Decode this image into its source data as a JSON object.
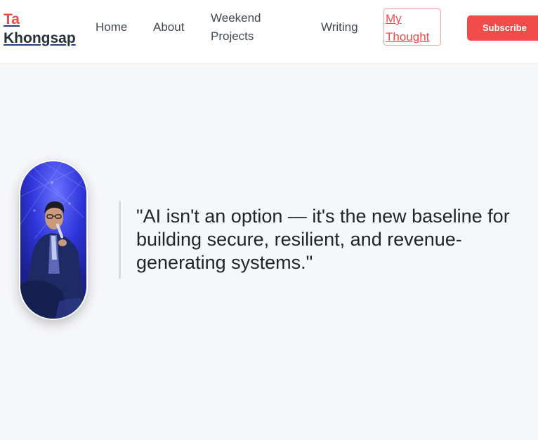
{
  "brand": {
    "first_name": "Ta",
    "last_name": "Khongsap"
  },
  "nav": {
    "items": [
      {
        "label": "Home"
      },
      {
        "label": "About"
      },
      {
        "label": "Weekend Projects"
      },
      {
        "label": "Writing"
      },
      {
        "label": "My Thought",
        "active": true
      }
    ],
    "subscribe_label": "Subscribe"
  },
  "hero": {
    "quote": "\"AI isn't an option — it's the new baseline for building secure, resilient, and revenue-generating systems.\""
  },
  "colors": {
    "accent": "#f24b4b",
    "brand_underline": "#1f3f8c",
    "page_background": "#f6f7f9",
    "text": "#212529"
  }
}
